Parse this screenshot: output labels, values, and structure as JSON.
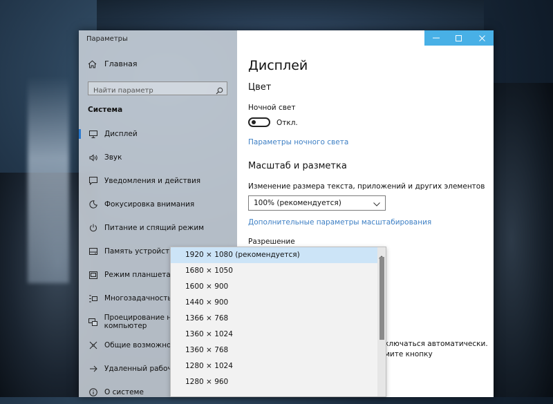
{
  "window": {
    "app_title": "Параметры",
    "controls": {
      "minimize": "minimize-icon",
      "maximize": "maximize-icon",
      "close": "close-icon"
    },
    "accent_color": "#48b0e6"
  },
  "sidebar": {
    "home": {
      "label": "Главная",
      "icon": "home-icon"
    },
    "search": {
      "placeholder": "Найти параметр",
      "icon": "search-icon"
    },
    "section": "Система",
    "items": [
      {
        "label": "Дисплей",
        "icon": "monitor-icon",
        "active": true
      },
      {
        "label": "Звук",
        "icon": "speaker-icon"
      },
      {
        "label": "Уведомления и действия",
        "icon": "notification-icon"
      },
      {
        "label": "Фокусировка внимания",
        "icon": "moon-icon"
      },
      {
        "label": "Питание и спящий режим",
        "icon": "power-icon"
      },
      {
        "label": "Память устройства",
        "icon": "storage-icon"
      },
      {
        "label": "Режим планшета",
        "icon": "tablet-icon"
      },
      {
        "label": "Многозадачность",
        "icon": "multitask-icon"
      },
      {
        "label": "Проецирование на этот компьютер",
        "icon": "project-icon"
      },
      {
        "label": "Общие возможности",
        "icon": "share-icon"
      },
      {
        "label": "Удаленный рабочий стол",
        "icon": "remote-desktop-icon"
      },
      {
        "label": "О системе",
        "icon": "info-icon"
      }
    ]
  },
  "main": {
    "title": "Дисплей",
    "color_section": "Цвет",
    "night_light_label": "Ночной свет",
    "night_light_state": "Откл.",
    "night_light_link": "Параметры ночного света",
    "scale_section": "Масштаб и разметка",
    "scale_label": "Изменение размера текста, приложений и других элементов",
    "scale_value": "100% (рекомендуется)",
    "scale_link": "Дополнительные параметры масштабирования",
    "resolution_label": "Разрешение",
    "behind_text_1": "ключаться автоматически.",
    "behind_text_2": "мите кнопку"
  },
  "resolution_dropdown": {
    "options": [
      "1920 × 1080 (рекомендуется)",
      "1680 × 1050",
      "1600 × 900",
      "1440 × 900",
      "1366 × 768",
      "1360 × 1024",
      "1360 × 768",
      "1280 × 1024",
      "1280 × 960"
    ],
    "selected_index": 0
  }
}
